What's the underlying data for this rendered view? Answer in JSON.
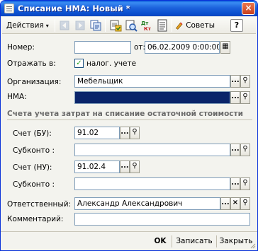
{
  "window": {
    "title": "Списание НМА: Новый *",
    "close_glyph": "×"
  },
  "toolbar": {
    "actions_label": "Действия",
    "actions_caret": "▾",
    "sovety_label": "Советы",
    "help_label": "?",
    "icons": [
      "go-back-icon",
      "go-forward-icon",
      "copy-icon",
      "post-document-icon",
      "print-preview-icon",
      "dt-kt-icon",
      "report-list-icon",
      "tips-icon",
      "help-icon"
    ],
    "dt_kt_label": "Дт Кт"
  },
  "form": {
    "number_label": "Номер:",
    "number_value": "",
    "date_prefix": "от:",
    "date_value": "06.02.2009  0:00:00",
    "reflect_label": "Отражать в:",
    "tax_checkbox_label": "налог. учете",
    "tax_checked": true,
    "org_label": "Организация:",
    "org_value": "Мебельщик",
    "nma_label": "НМА:",
    "nma_value": "",
    "section_title": "Счета учета затрат на списание остаточной стоимости",
    "schet_bu_label": "Счет (БУ):",
    "schet_bu_value": "91.02",
    "subkonto1_label": "Субконто :",
    "subkonto1_value": "",
    "schet_nu_label": "Счет (НУ):",
    "schet_nu_value": "91.02.4",
    "subkonto2_label": "Субконто :",
    "subkonto2_value": "",
    "responsible_label": "Ответственный:",
    "responsible_value": "Александр Александрович",
    "comment_label": "Комментарий:",
    "comment_value": ""
  },
  "buttons": {
    "select": "...",
    "search_glyph": "⚲",
    "clear_glyph": "×",
    "calendar_glyph": "▦"
  },
  "bottom": {
    "ok_label": "OK",
    "save_label": "Записать",
    "close_label": "Закрыть"
  },
  "colors": {
    "title_bar": "#0a5bd8",
    "selection": "#0a246a",
    "section_text": "#6a6a6a",
    "field_border": "#7f9db9"
  }
}
